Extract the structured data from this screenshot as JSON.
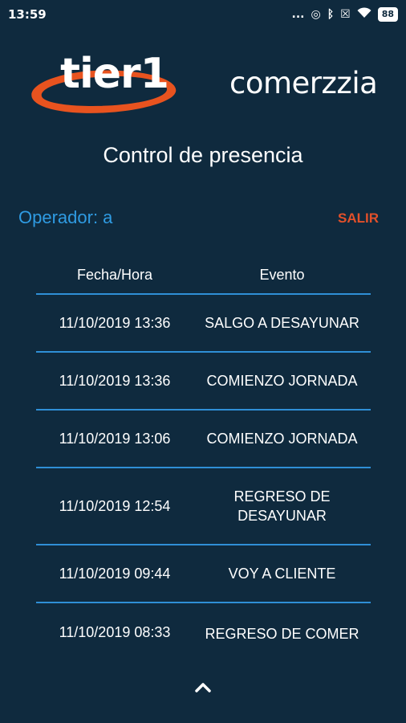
{
  "status_bar": {
    "time": "13:59",
    "dots": "...",
    "battery": "88"
  },
  "logos": {
    "tier1": "tier1",
    "comerzzia": "comerzzia"
  },
  "page": {
    "title": "Control de presencia"
  },
  "operator": {
    "label": "Operador: a",
    "logout_label": "SALIR"
  },
  "table": {
    "headers": [
      "Fecha/Hora",
      "Evento"
    ],
    "rows": [
      {
        "datetime": "11/10/2019 13:36",
        "event": "SALGO A DESAYUNAR"
      },
      {
        "datetime": "11/10/2019 13:36",
        "event": "COMIENZO JORNADA"
      },
      {
        "datetime": "11/10/2019 13:06",
        "event": "COMIENZO JORNADA"
      },
      {
        "datetime": "11/10/2019 12:54",
        "event": "REGRESO DE DESAYUNAR"
      },
      {
        "datetime": "11/10/2019 09:44",
        "event": "VOY A CLIENTE"
      },
      {
        "datetime": "11/10/2019 08:33",
        "event": "REGRESO DE COMER"
      }
    ]
  },
  "colors": {
    "background": "#0f2a3e",
    "accent_blue": "#2f9be2",
    "logout_red": "#e2502a",
    "logo_orange": "#e8531f"
  },
  "icons": {
    "scroll_up": "chevron-up-icon"
  }
}
